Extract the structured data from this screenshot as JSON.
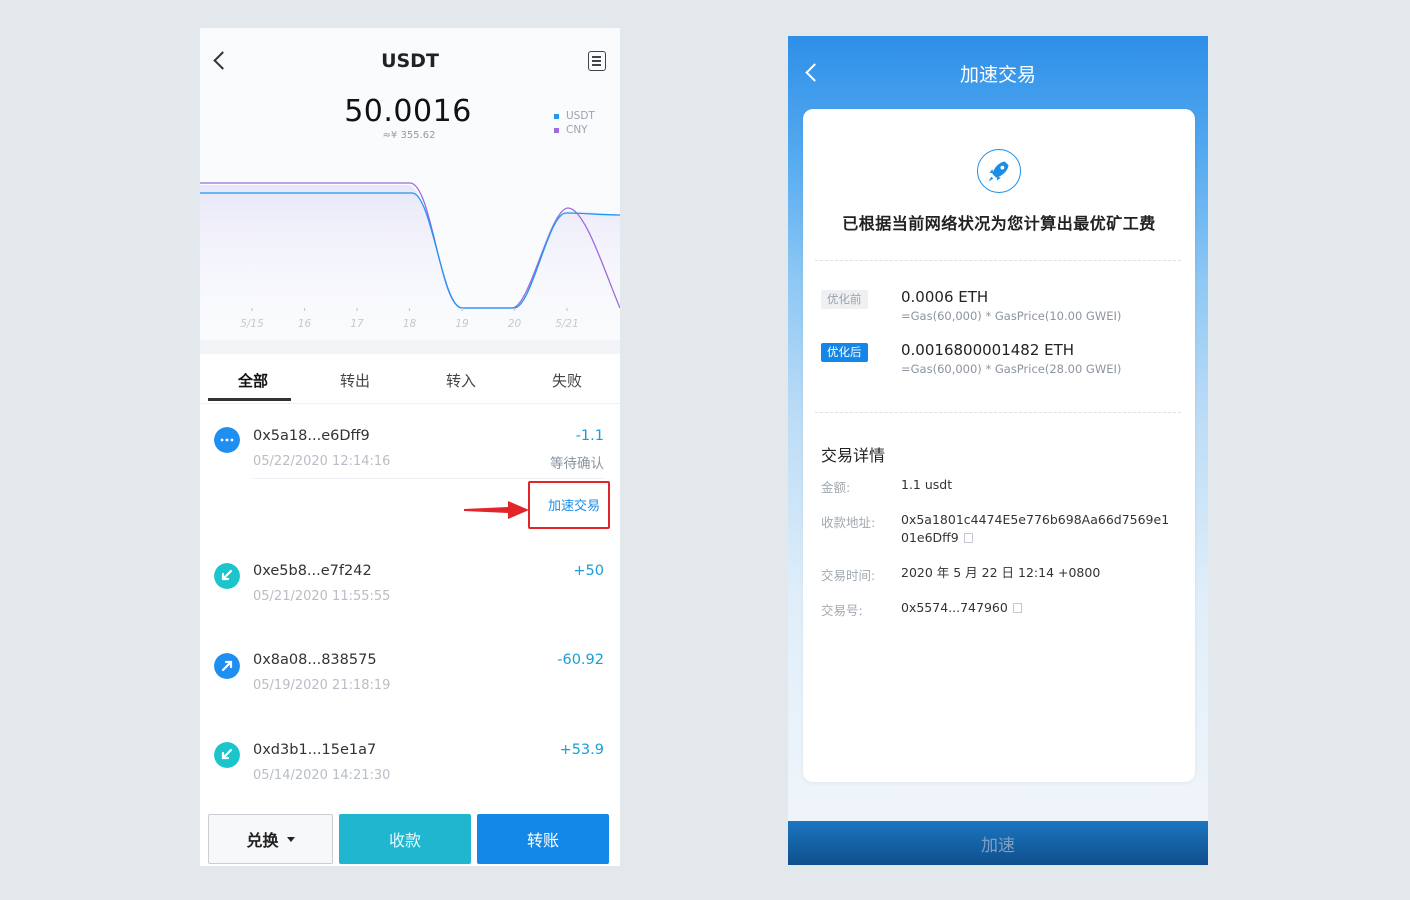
{
  "left": {
    "title": "USDT",
    "balance": "50.0016",
    "balance_cny": "≈¥ 355.62",
    "legend": [
      {
        "label": "USDT",
        "color": "#2196f3"
      },
      {
        "label": "CNY",
        "color": "#9c6ade"
      }
    ],
    "chart_data": {
      "type": "line",
      "categories": [
        "5/15",
        "16",
        "17",
        "18",
        "19",
        "20",
        "5/21"
      ]
    },
    "tabs": [
      "全部",
      "转出",
      "转入",
      "失败"
    ],
    "transactions": [
      {
        "hash": "0x5a18...e6Dff9",
        "time": "05/22/2020 12:14:16",
        "amount": "-1.1",
        "status": "等待确认",
        "icon": "pending-icon"
      },
      {
        "hash": "0xe5b8...e7f242",
        "time": "05/21/2020 11:55:55",
        "amount": "+50",
        "icon": "incoming-icon"
      },
      {
        "hash": "0x8a08...838575",
        "time": "05/19/2020 21:18:19",
        "amount": "-60.92",
        "icon": "outgoing-icon"
      },
      {
        "hash": "0xd3b1...15e1a7",
        "time": "05/14/2020 14:21:30",
        "amount": "+53.9",
        "icon": "incoming-icon"
      }
    ],
    "speed_link": "加速交易",
    "buttons": {
      "exchange": "兑换",
      "receive": "收款",
      "send": "转账"
    }
  },
  "right": {
    "title": "加速交易",
    "heading": "已根据当前网络状况为您计算出最优矿工费",
    "before": {
      "tag": "优化前",
      "value": "0.0006 ETH",
      "formula": "=Gas(60,000) * GasPrice(10.00 GWEI)"
    },
    "after": {
      "tag": "优化后",
      "value": "0.0016800001482 ETH",
      "formula": "=Gas(60,000) * GasPrice(28.00 GWEI)"
    },
    "details_title": "交易详情",
    "details": {
      "amount_label": "金额:",
      "amount": "1.1 usdt",
      "address_label": "收款地址:",
      "address_line1": "0x5a1801c4474E5e776b698Aa66d7569e1",
      "address_line2": "01e6Dff9",
      "time_label": "交易时间:",
      "time": "2020 年 5 月 22 日 12:14 +0800",
      "txid_label": "交易号:",
      "txid": "0x5574...747960"
    },
    "speed_button": "加速"
  }
}
